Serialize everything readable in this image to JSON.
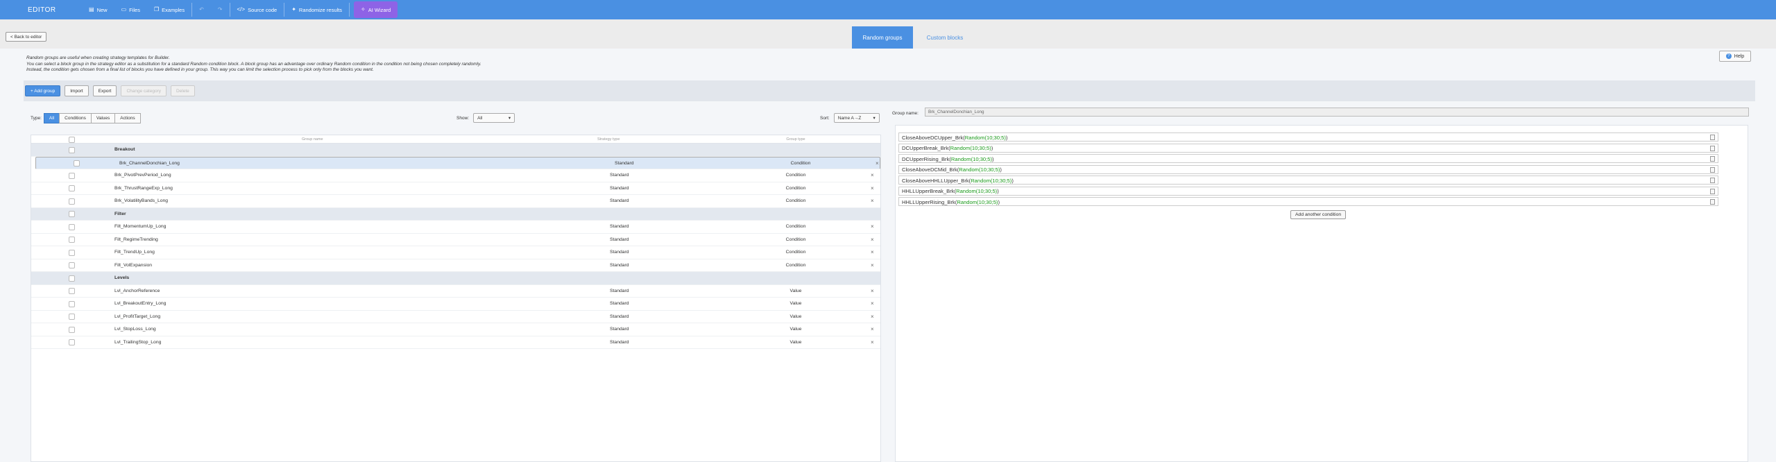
{
  "topbar": {
    "brand": "EDITOR",
    "new_label": "New",
    "files_label": "Files",
    "examples_label": "Examples",
    "undo_icon": "undo-icon",
    "redo_icon": "redo-icon",
    "source_label": "Source code",
    "randomize_label": "Randomize results",
    "wizard_label": "AI Wizard",
    "bg_color": "#4a90e2",
    "wizard_color": "#8e63e6"
  },
  "tabs": [
    {
      "label": "Random groups",
      "active": true
    },
    {
      "label": "Custom blocks",
      "active": false
    }
  ],
  "back_label": "< Back to editor",
  "help_label": "Help",
  "intro": [
    "Random groups are useful when creating strategy templates for Builder.",
    "You can select a block group in the strategy editor as a substitution for a standard Random condition block. A block group has an advantage over ordinary Random condition in the condition not being chosen completely randomly.",
    "Instead, the condition gets chosen from a final list of blocks you have defined in your group. This way you can limit the selection process to pick only from the blocks you want."
  ],
  "actions": {
    "add": "+ Add group",
    "import": "Import",
    "export": "Export",
    "change": "Change category",
    "delete": "Delete"
  },
  "filters": {
    "type_label": "Type:",
    "types": [
      "All",
      "Conditions",
      "Values",
      "Actions"
    ],
    "active_type": "All",
    "show_label": "Show:",
    "show_value": "All",
    "sort_label": "Sort:",
    "sort_value": "Name A→Z"
  },
  "table": {
    "headers": {
      "name": "Group name",
      "strategy_type": "Strategy type",
      "group_type": "Group type"
    },
    "rows": [
      {
        "kind": "category",
        "name": "Breakout"
      },
      {
        "kind": "item",
        "name": "Brk_ChannelDonchian_Long",
        "type": "Standard",
        "gtype": "Condition",
        "selected": true
      },
      {
        "kind": "item",
        "name": "Brk_PivotPrevPeriod_Long",
        "type": "Standard",
        "gtype": "Condition"
      },
      {
        "kind": "item",
        "name": "Brk_ThrustRangeExp_Long",
        "type": "Standard",
        "gtype": "Condition"
      },
      {
        "kind": "item",
        "name": "Brk_VolatilityBands_Long",
        "type": "Standard",
        "gtype": "Condition"
      },
      {
        "kind": "category",
        "name": "Filter"
      },
      {
        "kind": "item",
        "name": "Filt_MomentumUp_Long",
        "type": "Standard",
        "gtype": "Condition"
      },
      {
        "kind": "item",
        "name": "Filt_RegimeTrending",
        "type": "Standard",
        "gtype": "Condition"
      },
      {
        "kind": "item",
        "name": "Filt_TrendUp_Long",
        "type": "Standard",
        "gtype": "Condition"
      },
      {
        "kind": "item",
        "name": "Filt_VolExpansion",
        "type": "Standard",
        "gtype": "Condition"
      },
      {
        "kind": "category",
        "name": "Levels"
      },
      {
        "kind": "item",
        "name": "Lvl_AnchorReference",
        "type": "Standard",
        "gtype": "Value"
      },
      {
        "kind": "item",
        "name": "Lvl_BreakoutEntry_Long",
        "type": "Standard",
        "gtype": "Value"
      },
      {
        "kind": "item",
        "name": "Lvl_ProfitTarget_Long",
        "type": "Standard",
        "gtype": "Value"
      },
      {
        "kind": "item",
        "name": "Lvl_StopLoss_Long",
        "type": "Standard",
        "gtype": "Value"
      },
      {
        "kind": "item",
        "name": "Lvl_TrailingStop_Long",
        "type": "Standard",
        "gtype": "Value"
      }
    ]
  },
  "group_name": {
    "label": "Group name:",
    "value": "Brk_ChannelDonchian_Long"
  },
  "conditions": [
    {
      "name": "CloseAboveDCUpper_Brk",
      "args": "Random(10;30;5)"
    },
    {
      "name": "DCUpperBreak_Brk",
      "args": "Random(10;30;5)"
    },
    {
      "name": "DCUpperRising_Brk",
      "args": "Random(10;30;5)"
    },
    {
      "name": "CloseAboveDCMid_Brk",
      "args": "Random(10;30;5)"
    },
    {
      "name": "CloseAboveHHLLUpper_Brk",
      "args": "Random(10;30;5)"
    },
    {
      "name": "HHLLUpperBreak_Brk",
      "args": "Random(10;30;5)"
    },
    {
      "name": "HHLLUpperRising_Brk",
      "args": "Random(10;30;5)"
    }
  ],
  "add_condition_label": "Add another condition"
}
